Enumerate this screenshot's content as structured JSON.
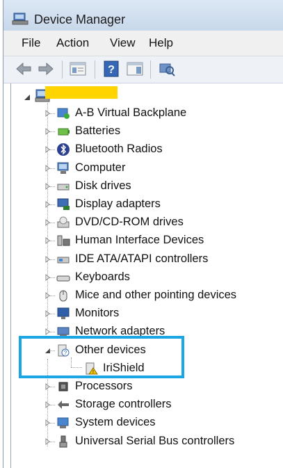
{
  "window": {
    "title": "Device Manager"
  },
  "menu": [
    {
      "name": "menu-file",
      "label": "File"
    },
    {
      "name": "menu-action",
      "label": "Action"
    },
    {
      "name": "menu-view",
      "label": "View"
    },
    {
      "name": "menu-help",
      "label": "Help"
    }
  ],
  "tree": {
    "items": [
      {
        "label": "A-B Virtual Backplane",
        "icon": "backplane-icon"
      },
      {
        "label": "Batteries",
        "icon": "battery-icon"
      },
      {
        "label": "Bluetooth Radios",
        "icon": "bluetooth-icon"
      },
      {
        "label": "Computer",
        "icon": "computer-icon"
      },
      {
        "label": "Disk drives",
        "icon": "disk-drive-icon"
      },
      {
        "label": "Display adapters",
        "icon": "display-adapter-icon"
      },
      {
        "label": "DVD/CD-ROM drives",
        "icon": "dvd-drive-icon"
      },
      {
        "label": "Human Interface Devices",
        "icon": "hid-icon"
      },
      {
        "label": "IDE ATA/ATAPI controllers",
        "icon": "ide-controller-icon"
      },
      {
        "label": "Keyboards",
        "icon": "keyboard-icon"
      },
      {
        "label": "Mice and other pointing devices",
        "icon": "mouse-icon"
      },
      {
        "label": "Monitors",
        "icon": "monitor-icon"
      },
      {
        "label": "Network adapters",
        "icon": "network-adapter-icon"
      },
      {
        "label": "Other devices",
        "icon": "unknown-device-icon",
        "expanded": true
      },
      {
        "label": "IriShield",
        "icon": "warning-device-icon",
        "child": true
      },
      {
        "label": "Processors",
        "icon": "processor-icon"
      },
      {
        "label": "Storage controllers",
        "icon": "storage-controller-icon"
      },
      {
        "label": "System devices",
        "icon": "system-device-icon"
      },
      {
        "label": "Universal Serial Bus controllers",
        "icon": "usb-icon"
      }
    ]
  },
  "colors": {
    "highlight": "#1aa6e4",
    "redaction": "#ffd400"
  }
}
